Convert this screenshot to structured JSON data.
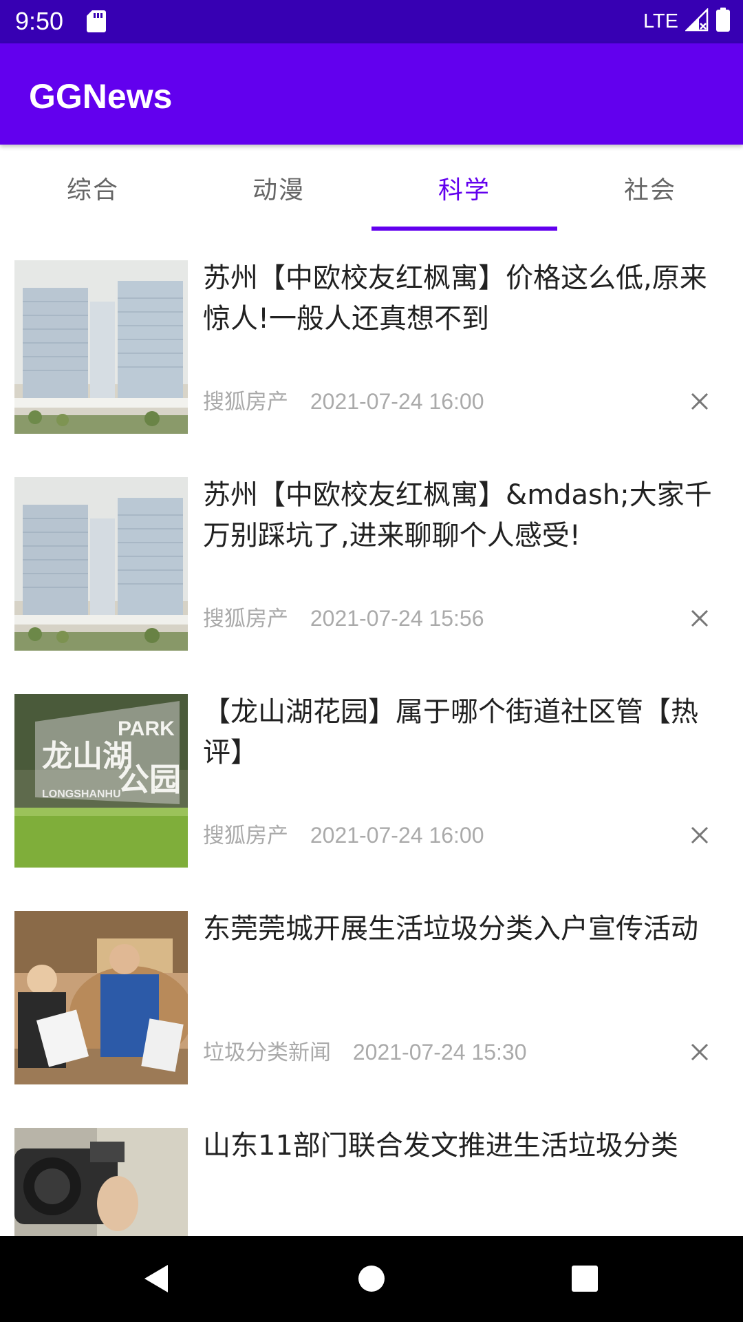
{
  "status_bar": {
    "time": "9:50",
    "network": "LTE",
    "icons": [
      "sd-card-icon",
      "signal-icon",
      "battery-icon"
    ]
  },
  "app": {
    "title": "GGNews"
  },
  "tabs": [
    {
      "label": "综合",
      "active": false
    },
    {
      "label": "动漫",
      "active": false
    },
    {
      "label": "科学",
      "active": true
    },
    {
      "label": "社会",
      "active": false
    }
  ],
  "news": [
    {
      "title": "苏州【中欧校友红枫寓】价格这么低,原来惊人!一般人还真想不到",
      "source": "搜狐房产",
      "time": "2021-07-24 16:00",
      "thumbnail": "building-model-photo"
    },
    {
      "title": "苏州【中欧校友红枫寓】&mdash;大家千万别踩坑了,进来聊聊个人感受!",
      "source": "搜狐房产",
      "time": "2021-07-24 15:56",
      "thumbnail": "building-model-photo"
    },
    {
      "title": "【龙山湖花园】属于哪个街道社区管【热评】",
      "source": "搜狐房产",
      "time": "2021-07-24 16:00",
      "thumbnail": "park-sign-photo",
      "thumbnail_text": [
        "龙山湖",
        "PARK",
        "公园",
        "LONGSHANHU"
      ]
    },
    {
      "title": "东莞莞城开展生活垃圾分类入户宣传活动",
      "source": "垃圾分类新闻",
      "time": "2021-07-24 15:30",
      "thumbnail": "officers-handing-leaflets-photo"
    },
    {
      "title": "山东11部门联合发文推进生活垃圾分类",
      "thumbnail": "camera-photo"
    }
  ],
  "colors": {
    "status_bar": "#3700b3",
    "primary": "#6200ee",
    "tab_inactive": "#666666",
    "title_text": "#212121",
    "meta_text": "#aaaaaa"
  }
}
